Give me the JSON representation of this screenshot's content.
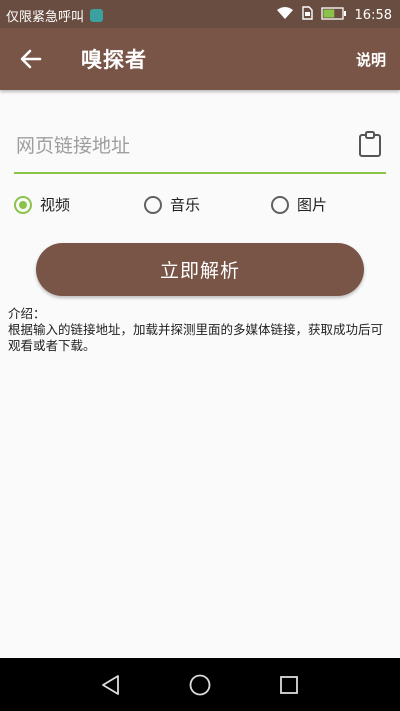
{
  "status_bar": {
    "carrier_text": "仅限紧急呼叫",
    "time": "16:58",
    "battery_level": 0.6,
    "icons": [
      "app-notification-icon",
      "wifi-icon",
      "sim-icon",
      "battery-icon"
    ]
  },
  "app_bar": {
    "title": "嗅探者",
    "help_label": "说明",
    "back_icon": "arrow-back-icon"
  },
  "url_input": {
    "placeholder": "网页链接地址",
    "value": "",
    "paste_icon": "clipboard-icon"
  },
  "media_types": {
    "options": [
      {
        "label": "视频",
        "checked": true
      },
      {
        "label": "音乐",
        "checked": false
      },
      {
        "label": "图片",
        "checked": false
      }
    ]
  },
  "parse_button": {
    "label": "立即解析"
  },
  "intro": {
    "heading": "介绍：",
    "body": "根据输入的链接地址，加载并探测里面的多媒体链接，获取成功后可观看或者下载。"
  },
  "nav_bar": {
    "icons": [
      "nav-back-icon",
      "nav-home-icon",
      "nav-recents-icon"
    ]
  },
  "colors": {
    "primary": "#795548",
    "status_bar": "#6a4d41",
    "accent": "#8bc34a",
    "background": "#fafafa"
  }
}
